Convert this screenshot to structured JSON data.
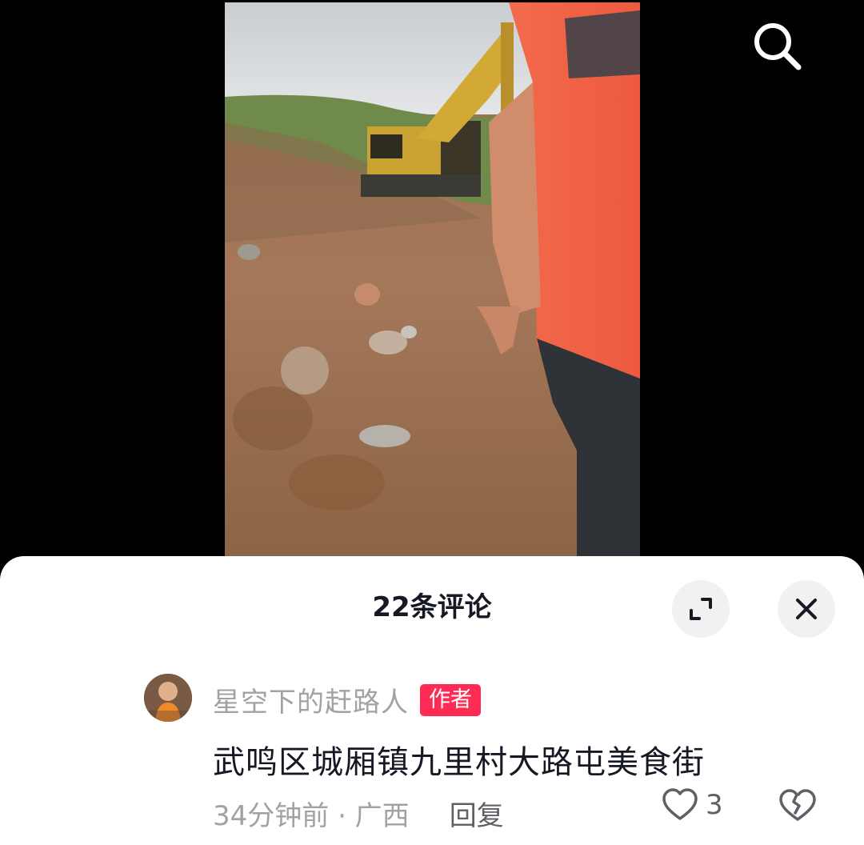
{
  "video": {
    "search_icon": "search-icon"
  },
  "comments_panel": {
    "title": "22条评论",
    "expand_icon": "expand-icon",
    "close_icon": "close-icon"
  },
  "comment": {
    "username": "星空下的赶路人",
    "badge": "作者",
    "text": "武鸣区城厢镇九里村大路屯美食街",
    "time_location": "34分钟前 · 广西",
    "reply_label": "回复",
    "like_count": "3",
    "like_icon": "heart-icon",
    "dislike_icon": "broken-heart-icon"
  },
  "colors": {
    "accent": "#fe2c55",
    "text_primary": "#161823",
    "text_secondary": "#a1a1a6"
  }
}
